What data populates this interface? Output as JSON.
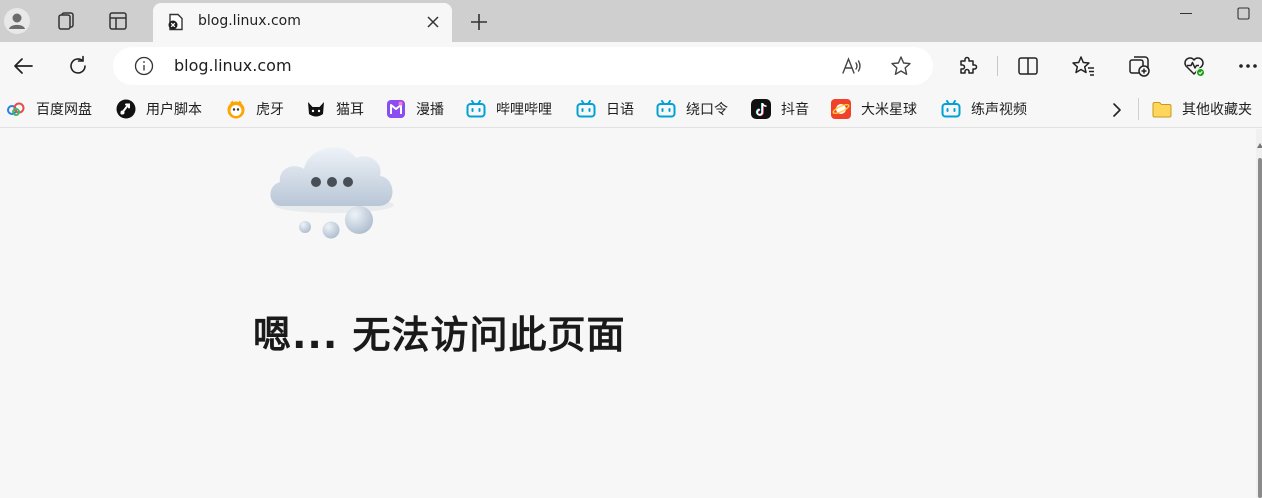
{
  "tab": {
    "title": "blog.linux.com"
  },
  "address_bar": {
    "url": "blog.linux.com"
  },
  "bookmarks": [
    {
      "label": "百度网盘",
      "icon": "baidu-netdisk-icon"
    },
    {
      "label": "用户脚本",
      "icon": "userscript-icon"
    },
    {
      "label": "虎牙",
      "icon": "huya-icon"
    },
    {
      "label": "猫耳",
      "icon": "cat-ear-icon"
    },
    {
      "label": "漫播",
      "icon": "manbo-icon"
    },
    {
      "label": "哔哩哔哩",
      "icon": "bilibili-icon"
    },
    {
      "label": "日语",
      "icon": "bilibili-icon"
    },
    {
      "label": "绕口令",
      "icon": "bilibili-icon"
    },
    {
      "label": "抖音",
      "icon": "douyin-icon"
    },
    {
      "label": "大米星球",
      "icon": "dami-icon"
    },
    {
      "label": "练声视频",
      "icon": "bilibili-icon"
    }
  ],
  "other_bookmarks": {
    "label": "其他收藏夹",
    "icon": "folder-icon"
  },
  "error": {
    "title": "嗯... 无法访问此页面"
  },
  "colors": {
    "bilibili": "#00a1d6",
    "tabstrip": "#cfcfcf",
    "page": "#f7f7f7"
  }
}
